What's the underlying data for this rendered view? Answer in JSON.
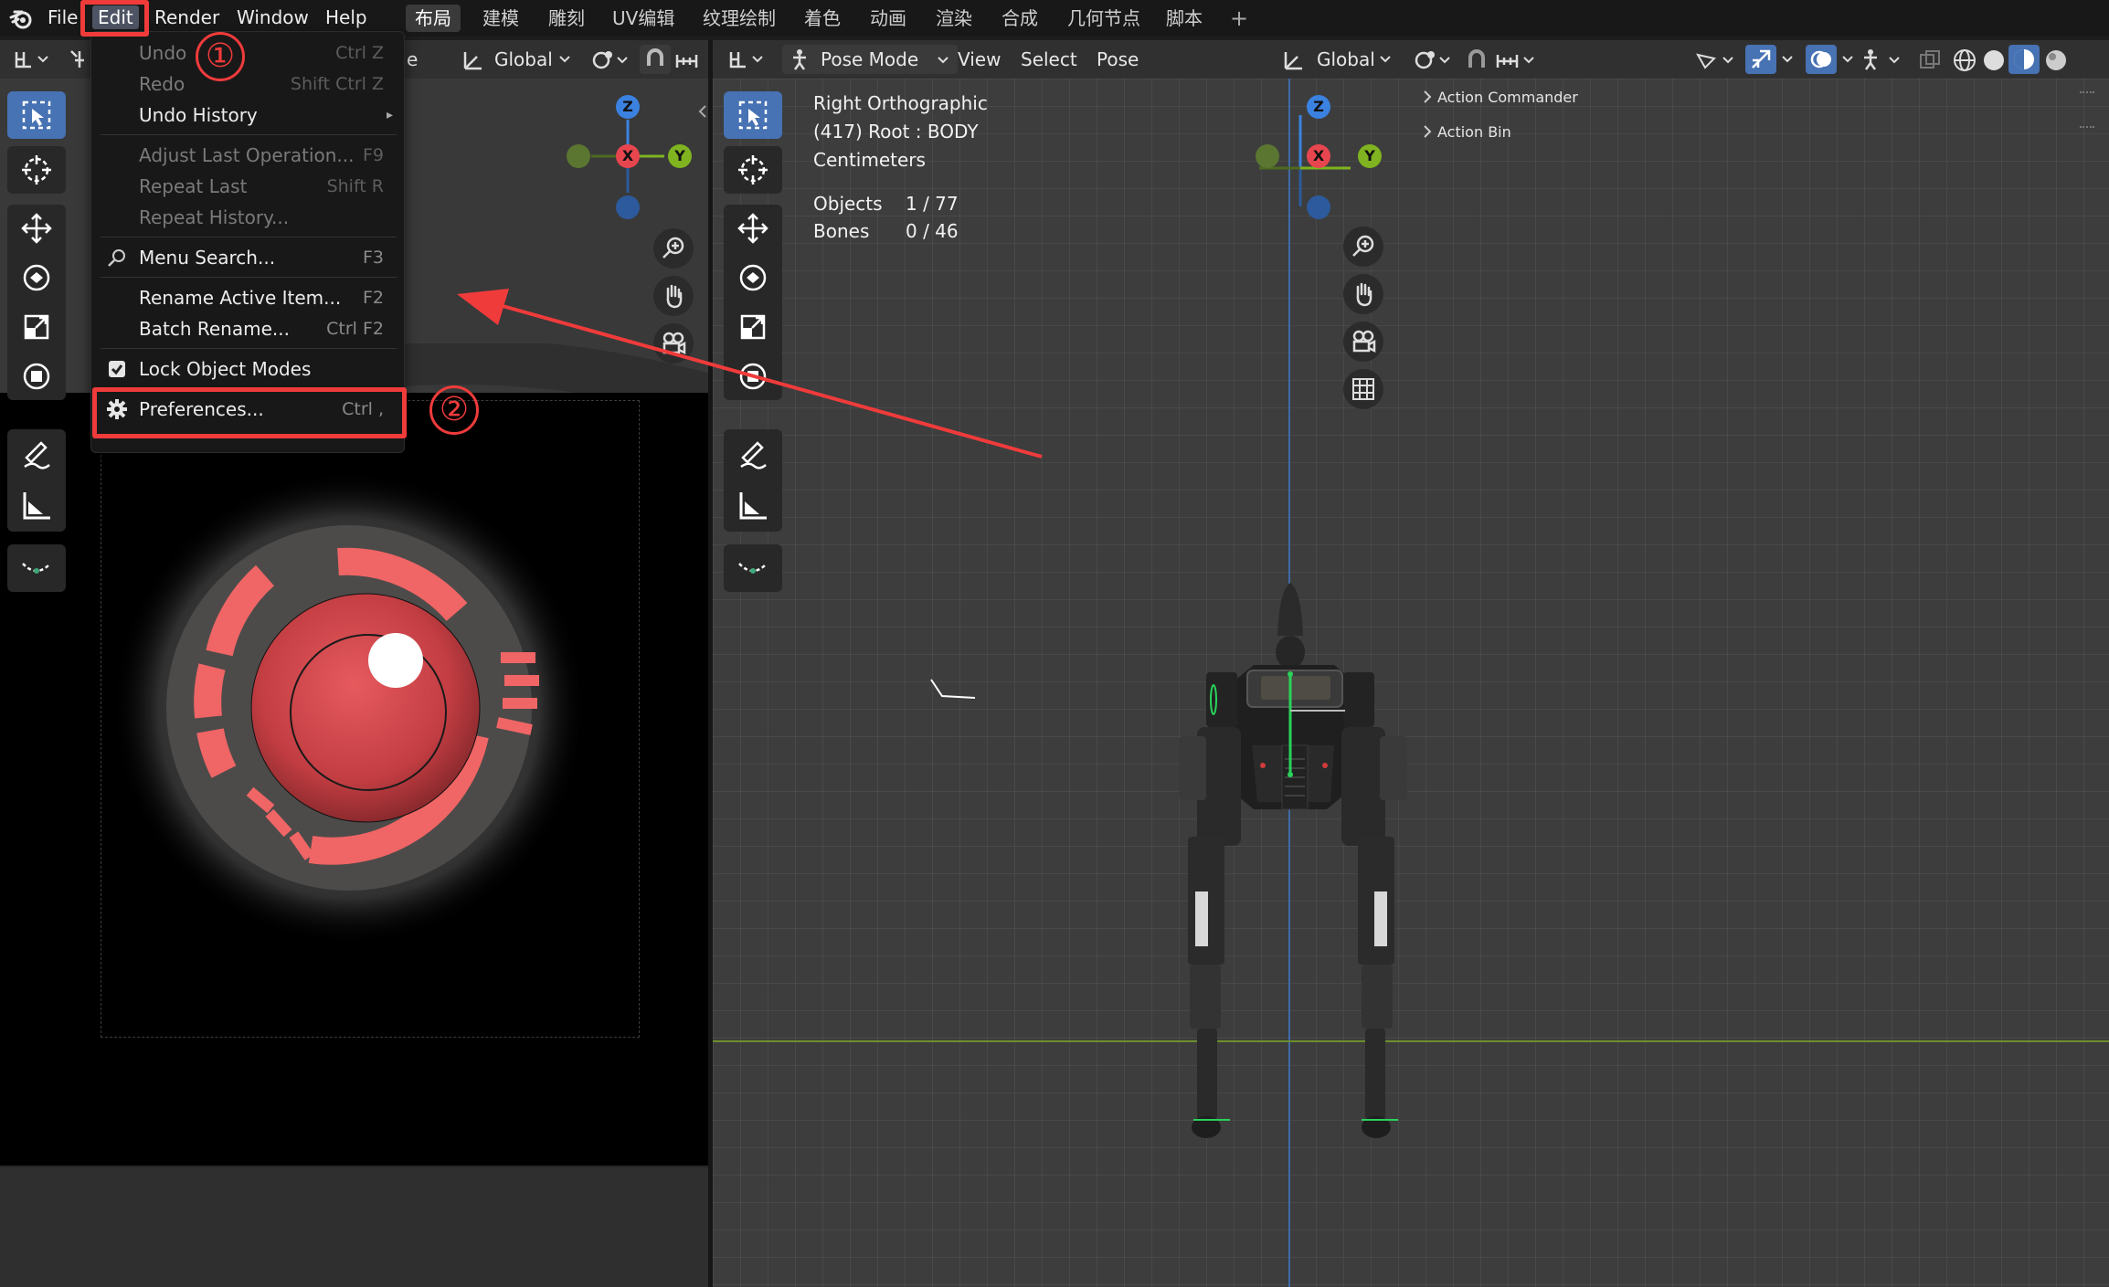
{
  "topbar": {
    "menus": [
      "File",
      "Edit",
      "Render",
      "Window",
      "Help"
    ],
    "workspaces": [
      "布局",
      "建模",
      "雕刻",
      "UV编辑",
      "纹理绘制",
      "着色",
      "动画",
      "渲染",
      "合成",
      "几何节点",
      "脚本"
    ],
    "add_tab": "+"
  },
  "left_editor": {
    "header_trailing": "e",
    "orientation": "Global"
  },
  "right_editor": {
    "mode": "Pose Mode",
    "menus": [
      "View",
      "Select",
      "Pose"
    ],
    "orientation": "Global"
  },
  "viewport_overlay": {
    "view_name": "Right Orthographic",
    "active": "(417) Root : BODY",
    "units": "Centimeters",
    "objects_label": "Objects",
    "objects_value": "1 / 77",
    "bones_label": "Bones",
    "bones_value": "0 / 46"
  },
  "side_panel": {
    "items": [
      "Action Commander",
      "Action Bin"
    ]
  },
  "gizmo": {
    "x": "X",
    "y": "Y",
    "z": "Z"
  },
  "edit_menu": {
    "items": [
      {
        "label": "Undo",
        "shortcut": "Ctrl Z",
        "disabled": true
      },
      {
        "label": "Redo",
        "shortcut": "Shift Ctrl Z",
        "disabled": true
      },
      {
        "label": "Undo History",
        "shortcut": "▸",
        "disabled": false
      },
      {
        "label": "Adjust Last Operation...",
        "shortcut": "F9",
        "disabled": true
      },
      {
        "label": "Repeat Last",
        "shortcut": "Shift R",
        "disabled": true
      },
      {
        "label": "Repeat History...",
        "shortcut": "",
        "disabled": true
      },
      {
        "label": "Menu Search...",
        "shortcut": "F3",
        "disabled": false
      },
      {
        "label": "Rename Active Item...",
        "shortcut": "F2",
        "disabled": false
      },
      {
        "label": "Batch Rename...",
        "shortcut": "Ctrl F2",
        "disabled": false
      },
      {
        "label": "Lock Object Modes",
        "shortcut": "",
        "disabled": false
      },
      {
        "label": "Preferences...",
        "shortcut": "Ctrl ,",
        "disabled": false
      }
    ]
  },
  "annotations": {
    "step1": "①",
    "step2": "②"
  },
  "colors": {
    "accent_blue": "#4772b3",
    "annotation_red": "#f03b3b",
    "axis_x": "#e8464f",
    "axis_y": "#7fb320",
    "axis_z": "#3b82e0"
  }
}
